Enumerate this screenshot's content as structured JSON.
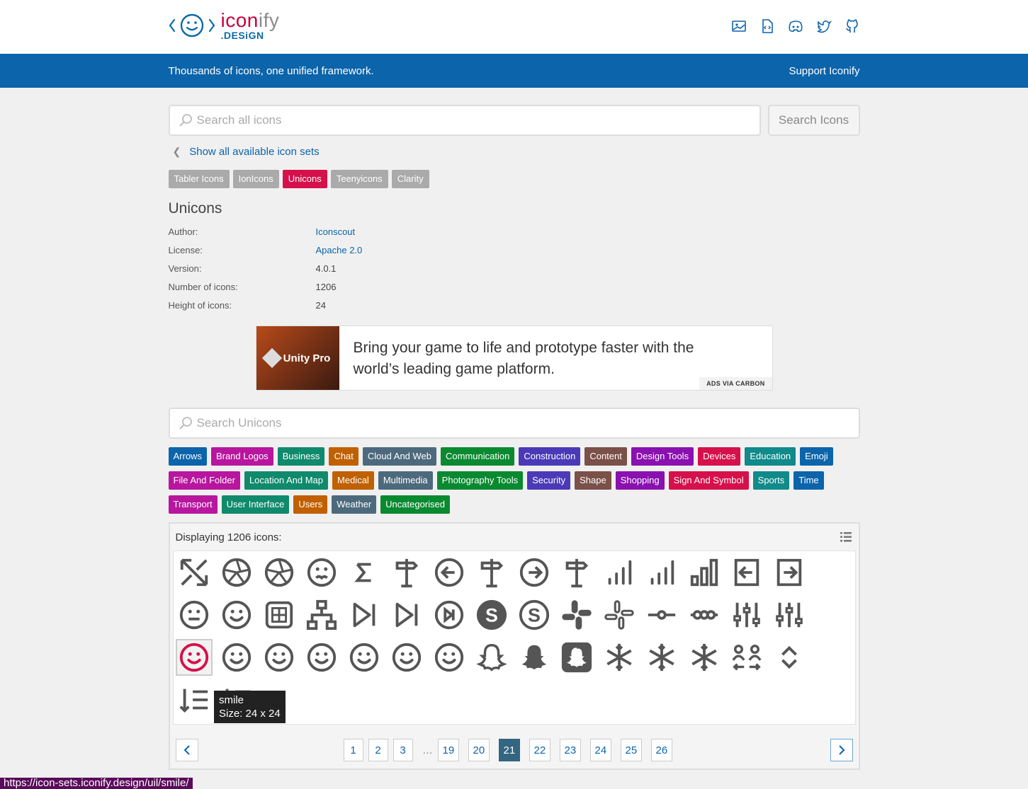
{
  "header": {
    "logo_text_main": "icon",
    "logo_text_fy": "ify",
    "logo_text_sub": ".DESiGN",
    "nav_icons": [
      "image-icon",
      "code-file-icon",
      "discord-icon",
      "twitter-icon",
      "github-icon"
    ]
  },
  "banner": {
    "tagline": "Thousands of icons, one unified framework.",
    "support_link": "Support Iconify"
  },
  "search": {
    "placeholder": "Search all icons",
    "button_label": "Search Icons"
  },
  "show_all_link": "Show all available icon sets",
  "set_tabs": [
    {
      "label": "Tabler Icons",
      "active": false
    },
    {
      "label": "IonIcons",
      "active": false
    },
    {
      "label": "Unicons",
      "active": true
    },
    {
      "label": "Teenyicons",
      "active": false
    },
    {
      "label": "Clarity",
      "active": false
    }
  ],
  "set_info": {
    "title": "Unicons",
    "rows": [
      {
        "key": "Author:",
        "value": "Iconscout",
        "link": true
      },
      {
        "key": "License:",
        "value": "Apache 2.0",
        "link": true
      },
      {
        "key": "Version:",
        "value": "4.0.1",
        "link": false
      },
      {
        "key": "Number of icons:",
        "value": "1206",
        "link": false
      },
      {
        "key": "Height of icons:",
        "value": "24",
        "link": false
      }
    ]
  },
  "ad": {
    "brand": "Unity Pro",
    "text": "Bring your game to life and prototype faster with the world’s leading game platform.",
    "via": "ADS VIA CARBON"
  },
  "filter": {
    "placeholder": "Search Unicons"
  },
  "categories": [
    {
      "label": "Arrows",
      "color": "#0c64ab"
    },
    {
      "label": "Brand Logos",
      "color": "#b8169e"
    },
    {
      "label": "Business",
      "color": "#108a6c"
    },
    {
      "label": "Chat",
      "color": "#c06000"
    },
    {
      "label": "Cloud And Web",
      "color": "#4d6a7d"
    },
    {
      "label": "Communication",
      "color": "#0a8a30"
    },
    {
      "label": "Construction",
      "color": "#4a3ab8"
    },
    {
      "label": "Content",
      "color": "#7a5048"
    },
    {
      "label": "Design Tools",
      "color": "#8a10b0"
    },
    {
      "label": "Devices",
      "color": "#d6104b"
    },
    {
      "label": "Education",
      "color": "#108a8a"
    },
    {
      "label": "Emoji",
      "color": "#0c64ab"
    },
    {
      "label": "File And Folder",
      "color": "#b8169e"
    },
    {
      "label": "Location And Map",
      "color": "#108a6c"
    },
    {
      "label": "Medical",
      "color": "#c06000"
    },
    {
      "label": "Multimedia",
      "color": "#4d6a7d"
    },
    {
      "label": "Photography Tools",
      "color": "#0a8a30"
    },
    {
      "label": "Security",
      "color": "#4a3ab8"
    },
    {
      "label": "Shape",
      "color": "#7a5048"
    },
    {
      "label": "Shopping",
      "color": "#8a10b0"
    },
    {
      "label": "Sign And Symbol",
      "color": "#d6104b"
    },
    {
      "label": "Sports",
      "color": "#108a8a"
    },
    {
      "label": "Time",
      "color": "#0c64ab"
    },
    {
      "label": "Transport",
      "color": "#b8169e"
    },
    {
      "label": "User Interface",
      "color": "#108a6c"
    },
    {
      "label": "Users",
      "color": "#c06000"
    },
    {
      "label": "Weather",
      "color": "#4d6a7d"
    },
    {
      "label": "Uncategorised",
      "color": "#0a8a30"
    }
  ],
  "results": {
    "count_text": "Displaying 1206 icons:",
    "icons": [
      "arrows-shrink-icon",
      "aperture-icon",
      "aperture-alt-icon",
      "frown-icon",
      "sigma-icon",
      "signpost-alt-icon",
      "arrow-circle-left-icon",
      "signpost-icon",
      "arrow-circle-right-icon",
      "signpost-right-icon",
      "signal-icon",
      "signal-alt-icon",
      "signal-bars-icon",
      "sign-in-icon",
      "sign-out-icon",
      "silence-icon",
      "sad-dizzy-icon",
      "sim-card-icon",
      "sitemap-icon",
      "skip-forward-icon",
      "skip-forward-alt-icon",
      "skip-forward-circle-icon",
      "skype-icon",
      "skype-alt-icon",
      "slack-icon",
      "slack-alt-icon",
      "slider-h-icon",
      "slider-h-range-icon",
      "sliders-v-icon",
      "sliders-v-alt-icon",
      "smile-icon",
      "smile-beam-icon",
      "smile-dizzy-icon",
      "smile-squint-wink-icon",
      "smile-squint-wink-alt-icon",
      "smile-wink-icon",
      "smile-wink-alt-icon",
      "snapchat-alt-icon",
      "snapchat-ghost-icon",
      "snapchat-square-icon",
      "snowflake-icon",
      "snowflake-alt-icon",
      "snow-flake-icon",
      "social-distancing-icon",
      "sort-icon",
      "sort-amount-down-icon",
      "sort-amount-up-icon"
    ],
    "selected_index": 30,
    "tooltip_name": "smile",
    "tooltip_size": "Size: 24 x 24"
  },
  "pagination": {
    "pages": [
      "1",
      "2",
      "3",
      "…",
      "19",
      "20",
      "21",
      "22",
      "23",
      "24",
      "25",
      "26"
    ],
    "active": "21"
  },
  "status_url": "https://icon-sets.iconify.design/uil/smile/"
}
